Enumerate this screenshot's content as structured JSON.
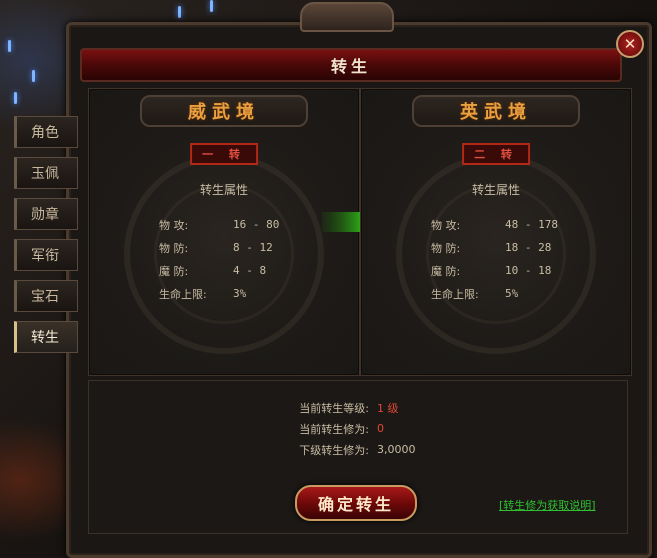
{
  "window": {
    "title": "转生",
    "close_glyph": "✕"
  },
  "tabs": [
    {
      "label": "角色",
      "active": false
    },
    {
      "label": "玉佩",
      "active": false
    },
    {
      "label": "勋章",
      "active": false
    },
    {
      "label": "军衔",
      "active": false
    },
    {
      "label": "宝石",
      "active": false
    },
    {
      "label": "转生",
      "active": true
    }
  ],
  "current": {
    "realm": "威武境",
    "level_badge": "一 转",
    "attr_head": "转生属性",
    "stats": [
      {
        "label": "物  攻:",
        "value": "16 - 80"
      },
      {
        "label": "物  防:",
        "value": "8 - 12"
      },
      {
        "label": "魔  防:",
        "value": "4 - 8"
      },
      {
        "label": "生命上限:",
        "value": "3%"
      }
    ]
  },
  "next": {
    "realm": "英武境",
    "level_badge": "二 转",
    "attr_head": "转生属性",
    "stats": [
      {
        "label": "物  攻:",
        "value": "48 - 178"
      },
      {
        "label": "物  防:",
        "value": "18 - 28"
      },
      {
        "label": "魔  防:",
        "value": "10 - 18"
      },
      {
        "label": "生命上限:",
        "value": "5%"
      }
    ]
  },
  "info": {
    "level_label": "当前转生等级:",
    "level_value": "1 级",
    "cultivation_label": "当前转生修为:",
    "cultivation_value": "0",
    "next_label": "下级转生修为:",
    "next_value": "3,0000"
  },
  "confirm_label": "确定转生",
  "help_link": "[转生修为获取说明]",
  "colors": {
    "accent_orange": "#e8a040",
    "title_red": "#7a1010",
    "link_green": "#30c030",
    "value_red": "#e04838",
    "arrow_green": "#3cc81e"
  }
}
